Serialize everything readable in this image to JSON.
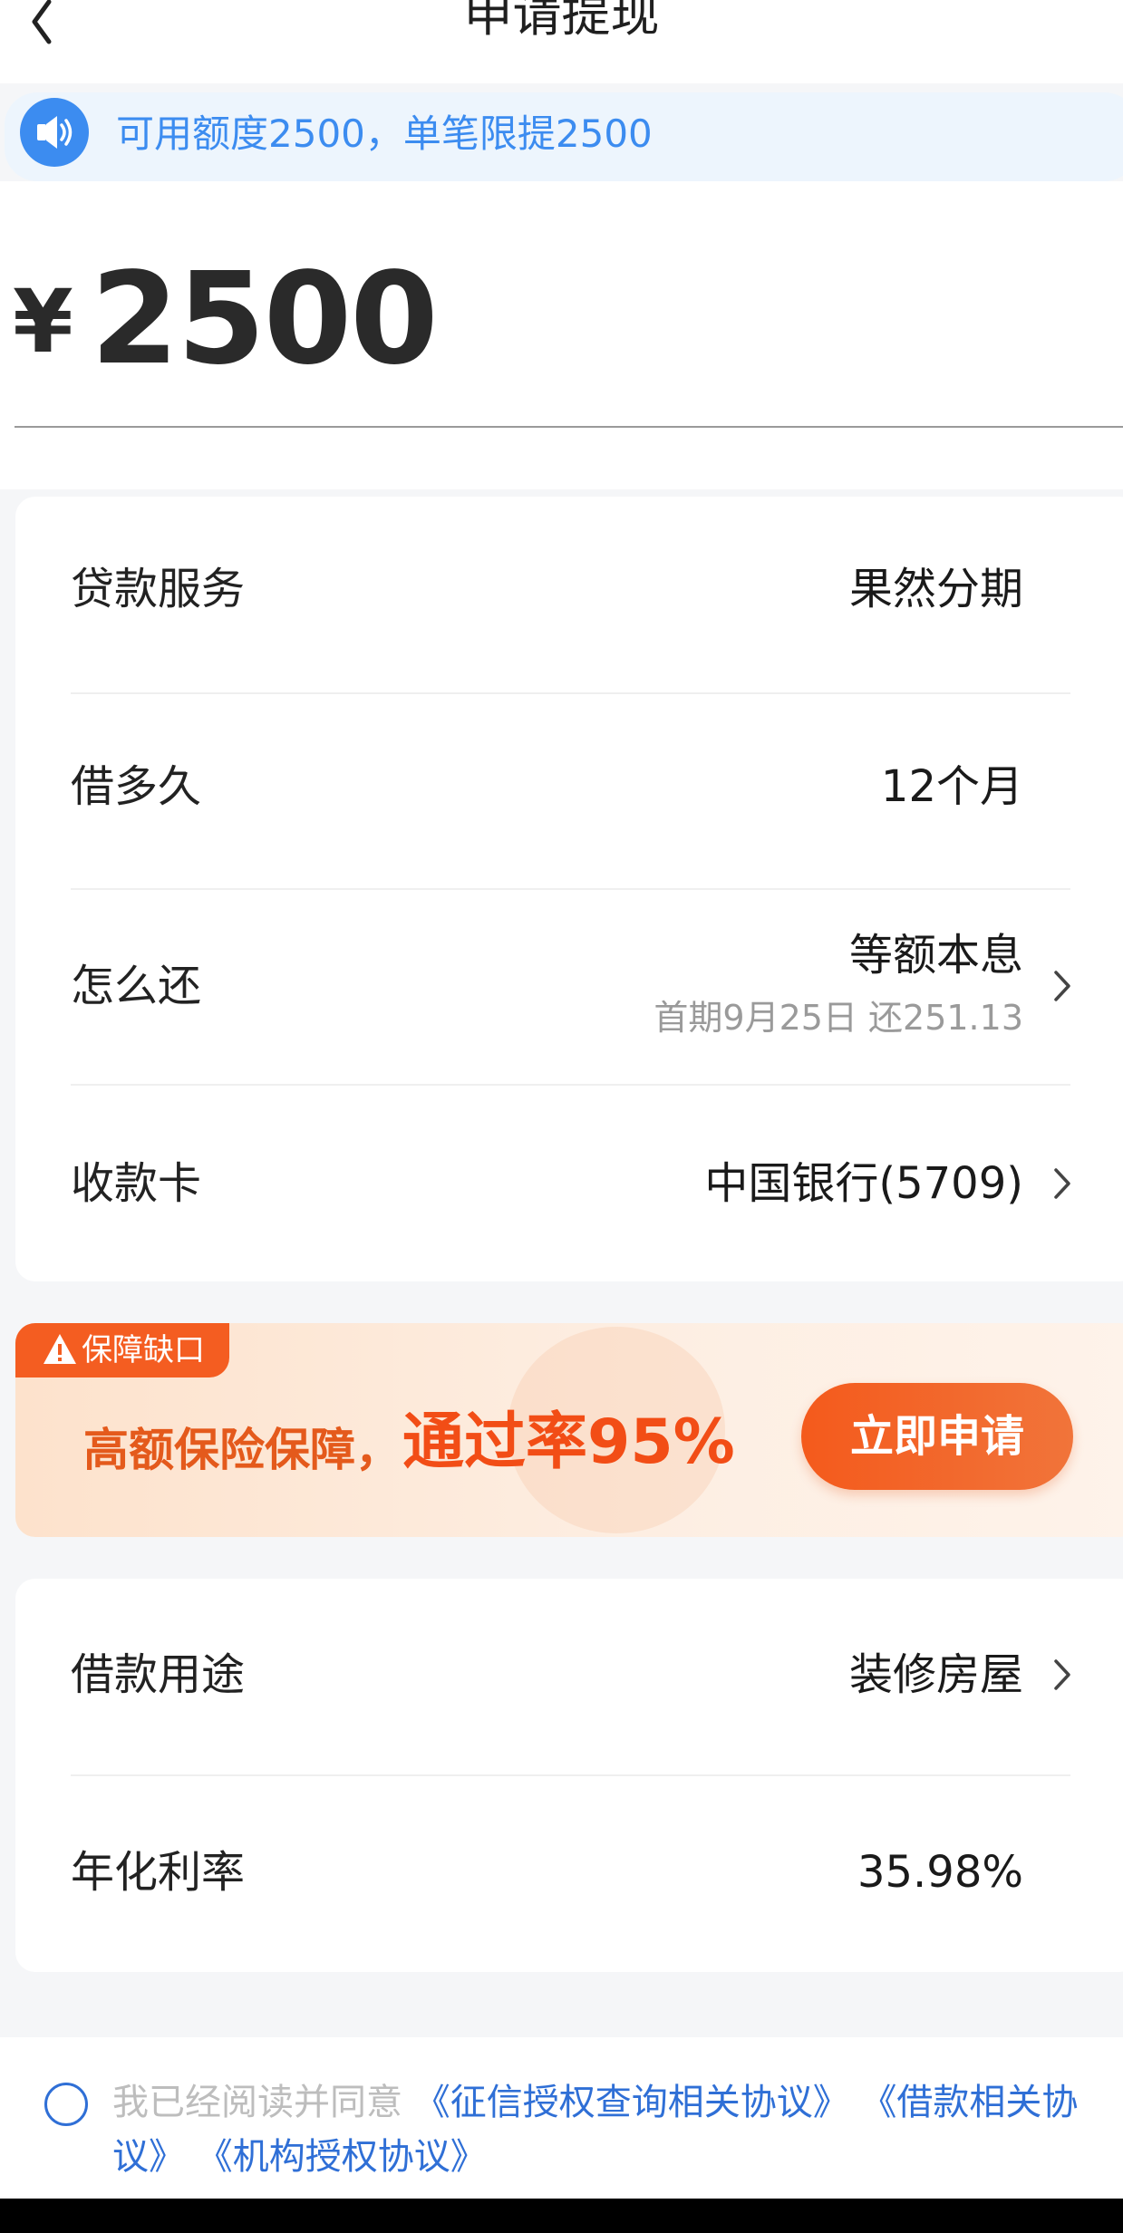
{
  "header": {
    "title": "申请提现"
  },
  "notice": {
    "text": "可用额度2500，单笔限提2500"
  },
  "amount": {
    "currency": "¥",
    "value": "2500"
  },
  "details": [
    {
      "label": "贷款服务",
      "value": "果然分期"
    },
    {
      "label": "借多久",
      "value": "12个月"
    },
    {
      "label": "怎么还",
      "value": "等额本息",
      "sub": "首期9月25日 还251.13"
    },
    {
      "label": "收款卡",
      "value": "中国银行(5709)"
    }
  ],
  "promo": {
    "badge": "保障缺口",
    "text_main": "高额保险保障，",
    "text_highlight": "通过率95%",
    "button": "立即申请"
  },
  "details2": [
    {
      "label": "借款用途",
      "value": "装修房屋"
    },
    {
      "label": "年化利率",
      "value": "35.98%"
    }
  ],
  "agreement": {
    "prefix": "我已经阅读并同意",
    "link1": "《征信授权查询相关协议》",
    "link2": "《借款相关协议》",
    "link3": "《机构授权协议》"
  },
  "colors": {
    "accent": "#3c8cf0",
    "promo": "#f24d16",
    "link": "#2f6fd6"
  }
}
